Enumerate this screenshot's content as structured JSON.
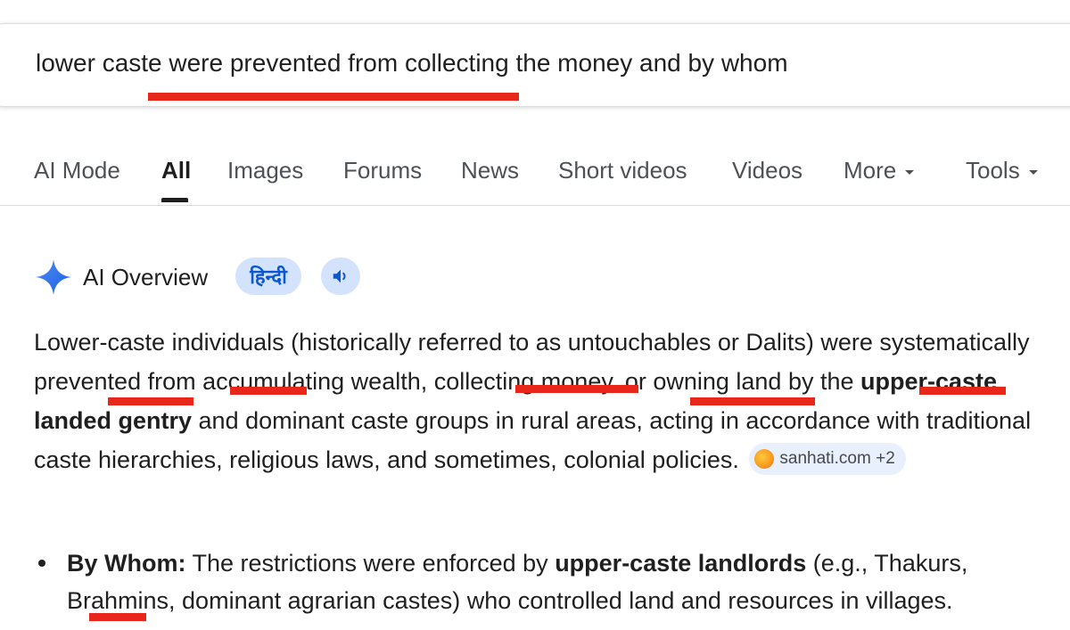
{
  "search": {
    "query": "lower caste were prevented from collecting the money and by whom"
  },
  "tabs": [
    {
      "label": "AI Mode"
    },
    {
      "label": "All"
    },
    {
      "label": "Images"
    },
    {
      "label": "Forums"
    },
    {
      "label": "News"
    },
    {
      "label": "Short videos"
    },
    {
      "label": "Videos"
    },
    {
      "label": "More"
    },
    {
      "label": "Tools"
    }
  ],
  "ai_overview": {
    "title": "AI Overview",
    "language_chip": "हिन्दी",
    "paragraph": {
      "part1": "Lower-caste individuals (historically referred to as untouchables or Dalits) were systematically prevented from accumulating wealth, collecting money, or owning land by the ",
      "bold1": "upper-caste landed gentry",
      "part2": " and dominant caste groups in rural areas, acting in accordance with traditional caste hierarchies, religious laws, and sometimes, colonial policies."
    },
    "source": {
      "label": "sanhati.com +2"
    },
    "bullets": [
      {
        "heading": "By Whom:",
        "text1": " The restrictions were enforced by ",
        "bold": "upper-caste landlords",
        "text2": " (e.g., Thakurs, Brahmins, dominant agrarian castes) who controlled land and resources in villages."
      }
    ]
  },
  "colors": {
    "accent_blue": "#0b57d0",
    "chip_bg": "#d3e3fd",
    "annotation_red": "#e8271a"
  },
  "icons": [
    "sparkle-icon",
    "speaker-icon",
    "chevron-down-icon",
    "source-favicon"
  ]
}
